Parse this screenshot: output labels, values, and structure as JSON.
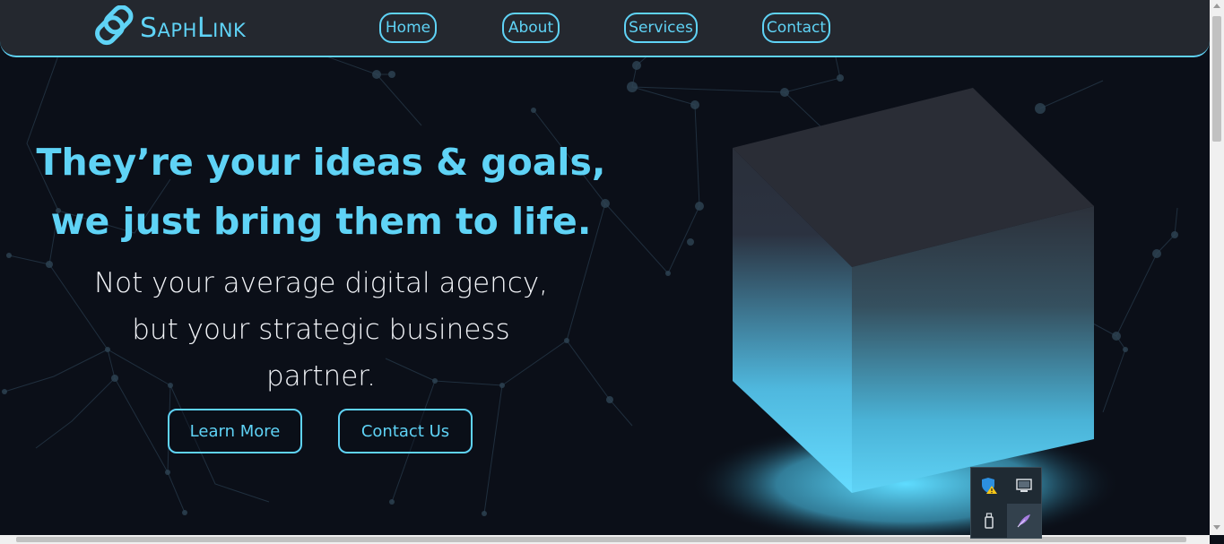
{
  "brand": {
    "name": "SaphLink",
    "accent": "#5fd3f6"
  },
  "nav": {
    "items": [
      {
        "label": "Home"
      },
      {
        "label": "About"
      },
      {
        "label": "Services"
      },
      {
        "label": "Contact"
      }
    ]
  },
  "hero": {
    "headline_line1": "They’re your ideas & goals,",
    "headline_line2": "we just bring them to life.",
    "sub_line1": "Not your average digital agency,",
    "sub_line2": "but your strategic business",
    "sub_line3": "partner.",
    "primary_cta": "Learn More",
    "secondary_cta": "Contact Us"
  },
  "colors": {
    "background": "#0b0f18",
    "navbar": "#24282f",
    "heading": "#5fd3f6",
    "body_text": "#f2f4f8"
  },
  "system_tray": {
    "icons": [
      "security-warning-icon",
      "display-icon",
      "usb-drive-icon",
      "feather-pen-icon"
    ]
  }
}
